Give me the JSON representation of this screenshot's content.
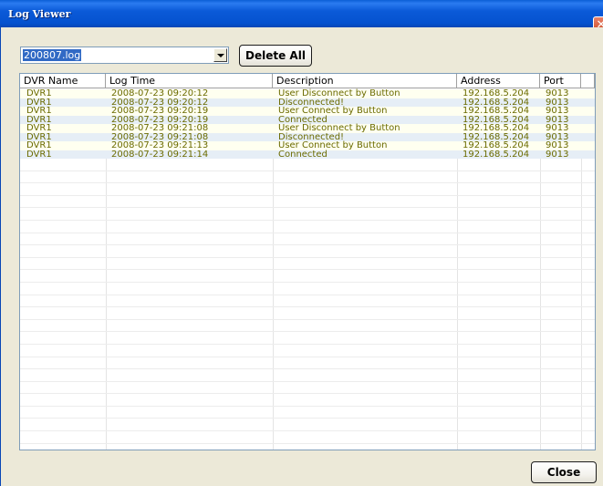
{
  "window": {
    "title": "Log Viewer",
    "close_glyph": "✕"
  },
  "log_file_select": {
    "value": "200807.log"
  },
  "buttons": {
    "delete_all": "Delete All",
    "close": "Close"
  },
  "table": {
    "columns": [
      "DVR Name",
      "Log Time",
      "Description",
      "Address",
      "Port"
    ],
    "rows": [
      [
        "DVR1",
        "2008-07-23 09:20:12",
        "User Disconnect by Button",
        "192.168.5.204",
        "9013"
      ],
      [
        "DVR1",
        "2008-07-23 09:20:12",
        "Disconnected!",
        "192.168.5.204",
        "9013"
      ],
      [
        "DVR1",
        "2008-07-23 09:20:19",
        "User Connect by Button",
        "192.168.5.204",
        "9013"
      ],
      [
        "DVR1",
        "2008-07-23 09:20:19",
        "Connected",
        "192.168.5.204",
        "9013"
      ],
      [
        "DVR1",
        "2008-07-23 09:21:08",
        "User Disconnect by Button",
        "192.168.5.204",
        "9013"
      ],
      [
        "DVR1",
        "2008-07-23 09:21:08",
        "Disconnected!",
        "192.168.5.204",
        "9013"
      ],
      [
        "DVR1",
        "2008-07-23 09:21:13",
        "User Connect by Button",
        "192.168.5.204",
        "9013"
      ],
      [
        "DVR1",
        "2008-07-23 09:21:14",
        "Connected",
        "192.168.5.204",
        "9013"
      ]
    ]
  }
}
